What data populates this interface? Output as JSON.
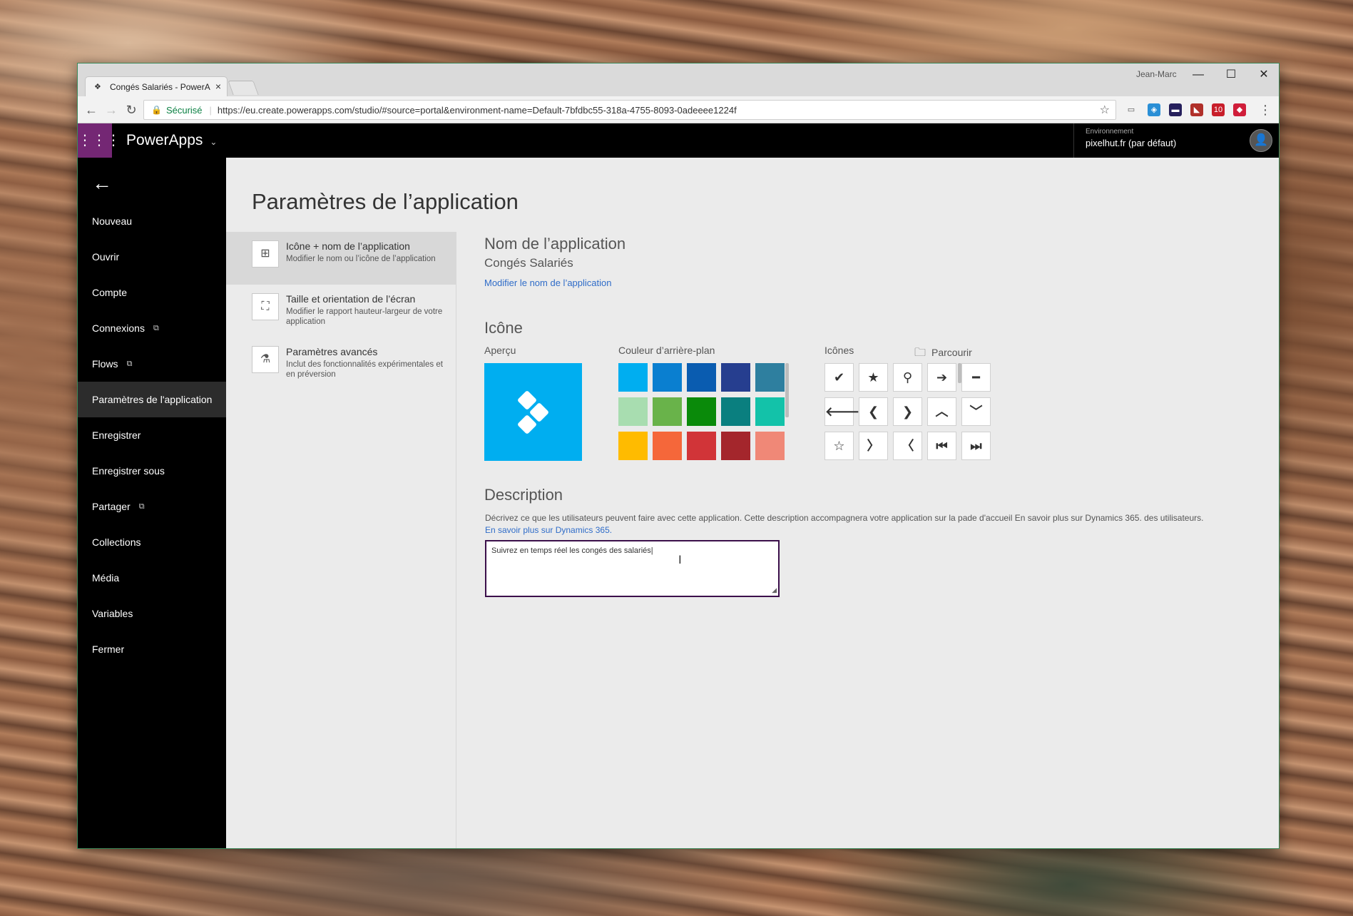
{
  "browser": {
    "tab_title": "Congés Salariés - PowerA",
    "tab_close": "×",
    "user": "Jean-Marc",
    "window_controls": {
      "minimize": "—",
      "maximize": "☐",
      "close": "✕"
    },
    "nav": {
      "back": "←",
      "forward": "→",
      "reload": "↻"
    },
    "secure_label": "Sécurisé",
    "url": "https://eu.create.powerapps.com/studio/#source=portal&environment-name=Default-7bfdbc55-318a-4755-8093-0adeeee1224f",
    "extensions": [
      "cast-icon",
      "shield-icon",
      "ext-icon",
      "ext-icon",
      "ext-icon",
      "ext-icon"
    ],
    "extension_badge": "10"
  },
  "appbar": {
    "brand": "PowerApps",
    "env_label": "Environnement",
    "env_name": "pixelhut.fr (par défaut)"
  },
  "sidebar": {
    "items": [
      {
        "label": "Nouveau"
      },
      {
        "label": "Ouvrir"
      },
      {
        "label": "Compte"
      },
      {
        "label": "Connexions",
        "external": true
      },
      {
        "label": "Flows",
        "external": true
      },
      {
        "label": "Paramètres de l'application",
        "active": true
      },
      {
        "label": "Enregistrer"
      },
      {
        "label": "Enregistrer sous"
      },
      {
        "label": "Partager",
        "external": true
      },
      {
        "label": "Collections"
      },
      {
        "label": "Média"
      },
      {
        "label": "Variables"
      },
      {
        "label": "Fermer"
      }
    ]
  },
  "page": {
    "title": "Paramètres de l’application",
    "options": [
      {
        "title": "Icône + nom de l’application",
        "desc": "Modifier le nom ou l’icône de l’application",
        "active": true
      },
      {
        "title": "Taille et orientation de l’écran",
        "desc": "Modifier le rapport hauteur-largeur de votre application"
      },
      {
        "title": "Paramètres avancés",
        "desc": "Inclut des fonctionnalités expérimentales et en préversion"
      }
    ],
    "app_name_heading": "Nom de l’application",
    "app_name": "Congés Salariés",
    "rename_link": "Modifier le nom de l’application",
    "icon_heading": "Icône",
    "preview_label": "Aperçu",
    "bg_color_label": "Couleur d’arrière-plan",
    "icons_label": "Icônes",
    "browse_label": "Parcourir",
    "swatches": [
      "#00aef0",
      "#0a7fd0",
      "#0a5cb0",
      "#263e8f",
      "#2e7f9f",
      "#a8ddb0",
      "#69b34a",
      "#0a8a0a",
      "#0a7f7f",
      "#13c2a9",
      "#ffbb00",
      "#f5673a",
      "#d13438",
      "#a4262c",
      "#f08877"
    ],
    "icons": [
      {
        "name": "check-icon",
        "glyph": "✔"
      },
      {
        "name": "star-icon",
        "glyph": "★"
      },
      {
        "name": "search-icon",
        "glyph": "⚲"
      },
      {
        "name": "arrow-right-icon",
        "glyph": "➔"
      },
      {
        "name": "minus-icon",
        "glyph": "━"
      },
      {
        "name": "arrow-left-icon",
        "glyph": "🡐"
      },
      {
        "name": "chevron-left-icon",
        "glyph": "❮"
      },
      {
        "name": "chevron-right-icon",
        "glyph": "❯"
      },
      {
        "name": "chevron-up-icon",
        "glyph": "︿"
      },
      {
        "name": "chevron-down-icon",
        "glyph": "﹀"
      },
      {
        "name": "star-outline-icon",
        "glyph": "☆"
      },
      {
        "name": "chevron-right-thin-icon",
        "glyph": "〉"
      },
      {
        "name": "chevron-left-thin-icon",
        "glyph": "〈"
      },
      {
        "name": "skip-back-icon",
        "glyph": "⏮"
      },
      {
        "name": "skip-forward-icon",
        "glyph": "⏭"
      }
    ],
    "description_heading": "Description",
    "description_help": "Décrivez ce que les utilisateurs peuvent faire avec cette application. Cette description accompagnera votre application sur la pade d'accueil En savoir plus sur Dynamics 365. des utilisateurs.",
    "description_help_link": "En savoir plus sur Dynamics 365.",
    "description_value": "Suivrez en temps réel les congés des salariés"
  }
}
